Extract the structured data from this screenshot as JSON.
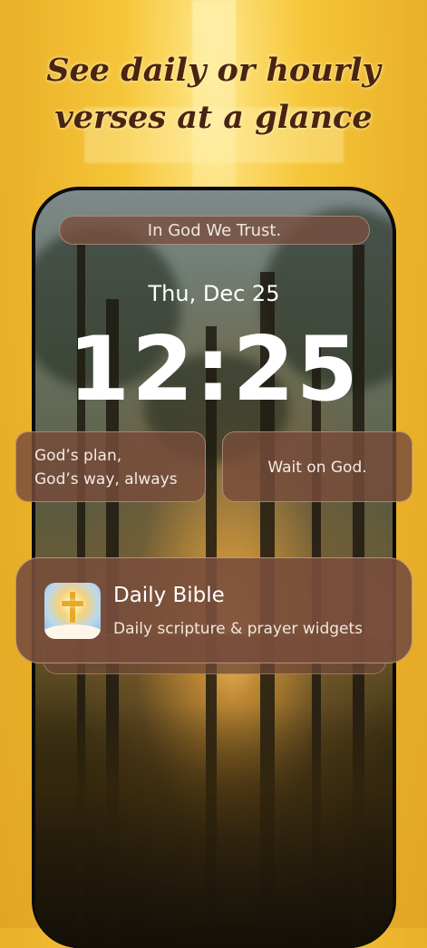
{
  "headline": {
    "line1": "See daily or hourly",
    "line2": "verses at a glance"
  },
  "lock_screen": {
    "top_widget": "In God We Trust.",
    "date": "Thu, Dec 25",
    "time": "12:25",
    "widget_left": {
      "line1": "God’s plan,",
      "line2": "God’s way, always"
    },
    "widget_right": "Wait on God."
  },
  "notification": {
    "app_icon": "cross-icon",
    "title": "Daily Bible",
    "body": "Daily scripture & prayer widgets"
  },
  "colors": {
    "background": "#eab22a",
    "headline_text": "#4a2410",
    "widget_fill": "#764c3a"
  }
}
